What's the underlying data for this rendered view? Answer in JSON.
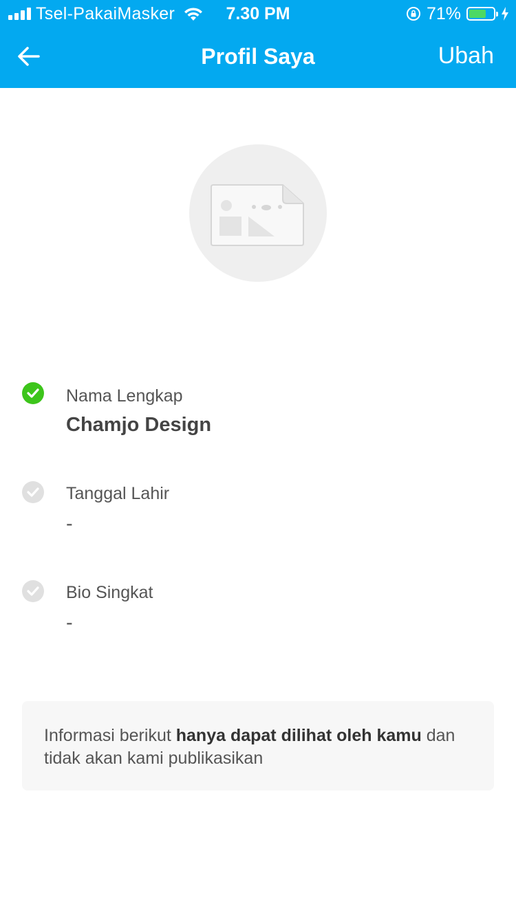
{
  "status_bar": {
    "carrier": "Tsel-PakaiMasker",
    "time": "7.30 PM",
    "battery_percent": "71%",
    "battery_level": 0.71
  },
  "nav": {
    "title": "Profil Saya",
    "edit_label": "Ubah"
  },
  "fields": [
    {
      "label": "Nama Lengkap",
      "value": "Chamjo Design",
      "verified": true
    },
    {
      "label": "Tanggal Lahir",
      "value": "-",
      "verified": false
    },
    {
      "label": "Bio Singkat",
      "value": "-",
      "verified": false
    }
  ],
  "info": {
    "text_before": "Informasi berikut ",
    "text_bold": "hanya dapat dilihat oleh kamu",
    "text_after": " dan tidak akan kami publikasikan"
  },
  "colors": {
    "primary": "#03a9f0",
    "verified": "#3dc51b",
    "pending": "#e0e0e0"
  }
}
